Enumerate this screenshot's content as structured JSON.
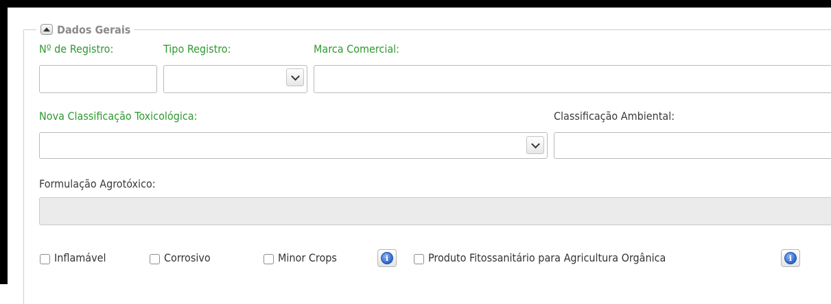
{
  "section": {
    "title": "Dados Gerais"
  },
  "fields": {
    "numero_registro": {
      "label": "Nº de Registro:",
      "value": ""
    },
    "tipo_registro": {
      "label": "Tipo Registro:",
      "value": ""
    },
    "marca_comercial": {
      "label": "Marca Comercial:",
      "value": ""
    },
    "nova_classificacao": {
      "label": "Nova Classificação Toxicológica:",
      "value": ""
    },
    "classificacao_ambiental": {
      "label": "Classificação Ambiental:",
      "value": ""
    },
    "formulacao": {
      "label": "Formulação Agrotóxico:",
      "value": ""
    }
  },
  "checkboxes": {
    "inflamavel": "Inflamável",
    "corrosivo": "Corrosivo",
    "minor_crops": "Minor Crops",
    "organica": "Produto Fitossanitário para Agricultura Orgânica"
  },
  "colors": {
    "required_label": "#2e9a2e",
    "label": "#3a3a3a",
    "info_icon": "#2c63c9"
  },
  "icons": {
    "collapse": "caret-up-icon",
    "dropdown": "chevron-down-icon",
    "info": "info-icon"
  }
}
